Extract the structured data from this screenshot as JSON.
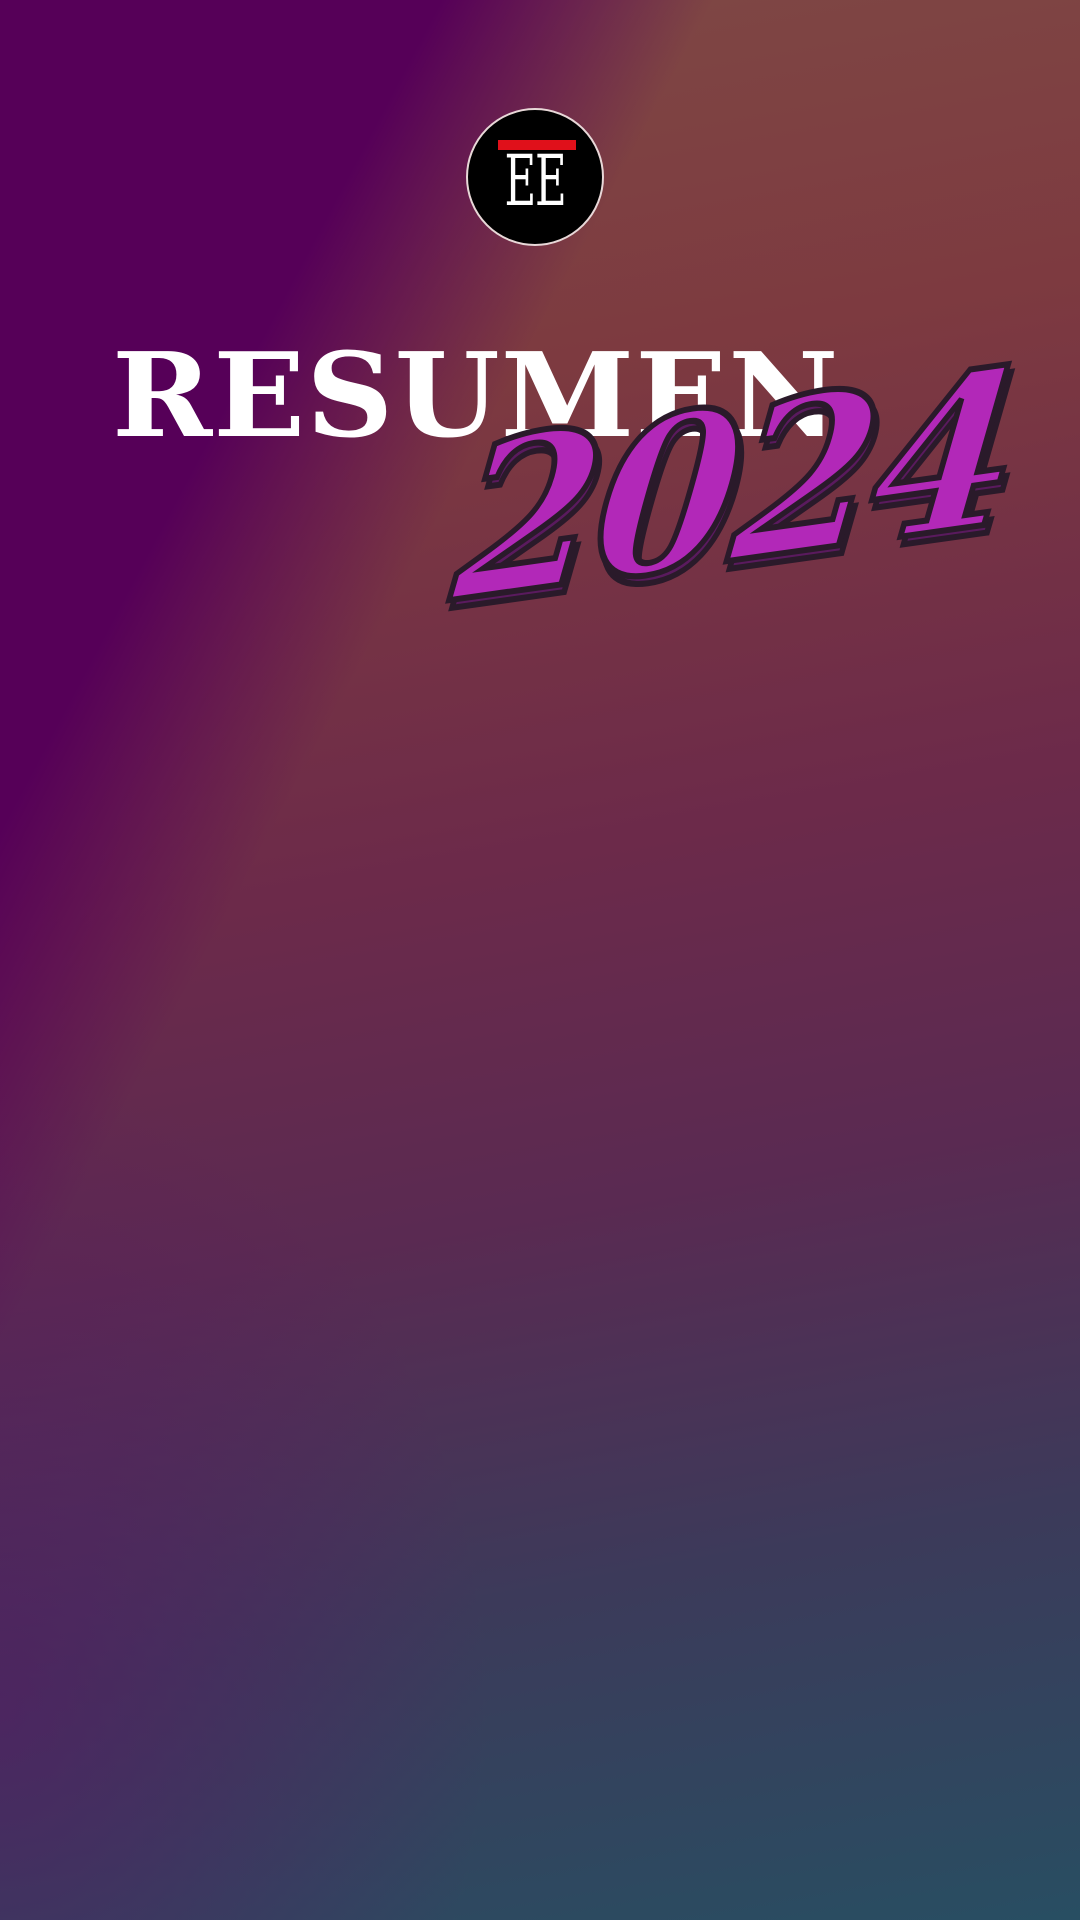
{
  "brand": {
    "logo_text": "EE",
    "logo_bar_color": "#e0101a"
  },
  "headline": {
    "title": "RESUMEN",
    "year": "2024",
    "year_color": "#b228b8"
  },
  "background": {
    "top_left_color": "#560058",
    "top_color": "#7f4a45",
    "bottom_color": "#284e62"
  }
}
